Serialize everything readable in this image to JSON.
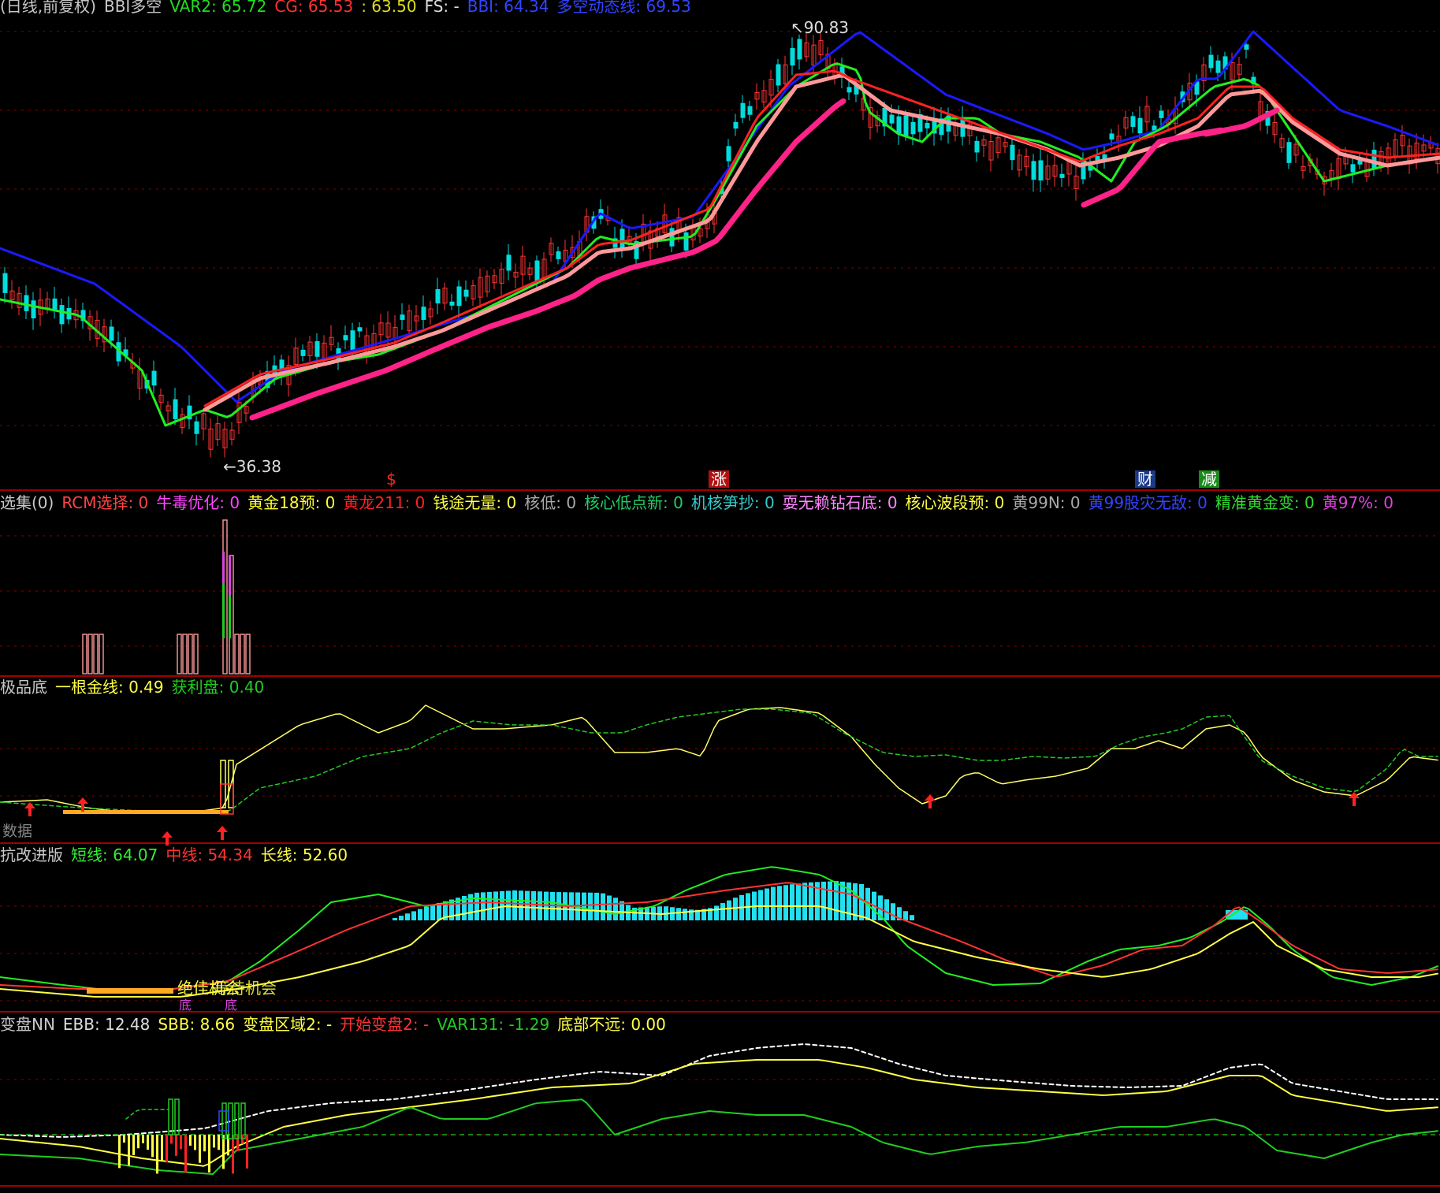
{
  "panels": {
    "main": {
      "header": [
        {
          "text": "(日线,前复权)",
          "color": "#c8c8c8"
        },
        {
          "text": "BBI多空",
          "color": "#c8c8c8"
        },
        {
          "text": "VAR2: 65.72",
          "color": "#22dd22"
        },
        {
          "text": "CG: 65.53",
          "color": "#ff3333"
        },
        {
          "text": ": 63.50",
          "color": "#dddd22"
        },
        {
          "text": "FS: -",
          "color": "#dddddd"
        },
        {
          "text": "BBI: 64.34",
          "color": "#3344ff"
        },
        {
          "text": "多空动态线: 69.53",
          "color": "#3344ff"
        }
      ],
      "price_high_label": "90.83",
      "price_low_label": "36.38",
      "signal_markers": [
        {
          "text": "$",
          "color": "#ff2222"
        },
        {
          "text": "涨",
          "color": "#ffffff",
          "bg": "#b01010"
        },
        {
          "text": "财",
          "color": "#ffffff",
          "bg": "#1c3a8a"
        },
        {
          "text": "减",
          "color": "#ffffff",
          "bg": "#1a8a1a"
        }
      ]
    },
    "p2": {
      "header": [
        {
          "text": "选集(0)",
          "color": "#c8c8c8"
        },
        {
          "text": "RCM选择: 0",
          "color": "#ff4444"
        },
        {
          "text": "牛毒优化: 0",
          "color": "#ff44ff"
        },
        {
          "text": "黄金18预: 0",
          "color": "#ffff33"
        },
        {
          "text": "黄龙211: 0",
          "color": "#ff2222"
        },
        {
          "text": "钱途无量: 0",
          "color": "#ffff44"
        },
        {
          "text": "核低: 0",
          "color": "#aaaaaa"
        },
        {
          "text": "核心低点新: 0",
          "color": "#22cc66"
        },
        {
          "text": "机核笋抄: 0",
          "color": "#33cccc"
        },
        {
          "text": "耍无赖钻石底: 0",
          "color": "#ff88ff"
        },
        {
          "text": "核心波段预: 0",
          "color": "#ffff44"
        },
        {
          "text": "黄99N: 0",
          "color": "#aaaaaa"
        },
        {
          "text": "黄99股灾无敌: 0",
          "color": "#3344ff"
        },
        {
          "text": "精准黄金变: 0",
          "color": "#33dd33"
        },
        {
          "text": "黄97%: 0",
          "color": "#dd44dd"
        }
      ]
    },
    "p3": {
      "header": [
        {
          "text": "极品底",
          "color": "#c8c8c8"
        },
        {
          "text": "一根金线: 0.49",
          "color": "#ffff44"
        },
        {
          "text": "获利盘: 0.40",
          "color": "#22cc22"
        }
      ],
      "nodata_label": "数据"
    },
    "p4": {
      "header": [
        {
          "text": "抗改进版",
          "color": "#c8c8c8"
        },
        {
          "text": "短线: 64.07",
          "color": "#33ee33"
        },
        {
          "text": "中线: 54.34",
          "color": "#ff3333"
        },
        {
          "text": "长线: 52.60",
          "color": "#ffff44"
        }
      ],
      "note_1": "绝佳机会",
      "note_2": "等待机会",
      "note_3": "底",
      "note_4": "底"
    },
    "p5": {
      "header": [
        {
          "text": "变盘NN",
          "color": "#c8c8c8"
        },
        {
          "text": "EBB: 12.48",
          "color": "#dddddd"
        },
        {
          "text": "SBB: 8.66",
          "color": "#ffff44"
        },
        {
          "text": "变盘区域2: -",
          "color": "#ffff44"
        },
        {
          "text": "开始变盘2: -",
          "color": "#ff3333"
        },
        {
          "text": "VAR131: -1.29",
          "color": "#22cc22"
        },
        {
          "text": "底部不远: 0.00",
          "color": "#ffff44"
        }
      ]
    }
  },
  "colors": {
    "up_candle": "#ff3333",
    "down_candle": "#00dddd",
    "bbi_line": "#1a1aff",
    "green_line": "#22ee22",
    "pink_line": "#ff2288",
    "salmon_line": "#ff9999",
    "red_line": "#ff2222",
    "cyan_bar": "#22e0f0",
    "grid": "#8a0000"
  }
}
